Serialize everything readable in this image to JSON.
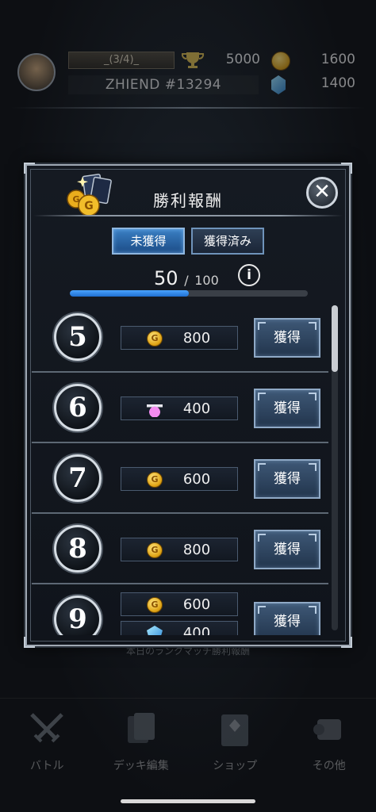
{
  "header": {
    "rank_label": "_(3/4)_",
    "trophy_count": "5000",
    "coin_count": "1600",
    "player_name": "ZHIEND  #13294",
    "gem_count": "1400",
    "icons": {
      "avatar": "avatar",
      "trophy": "trophy-icon",
      "coin": "gold-coin-icon",
      "gem": "blue-gem-icon"
    }
  },
  "modal": {
    "title": "勝利報酬",
    "close_label": "✕",
    "tabs": [
      {
        "label": "未獲得",
        "active": true
      },
      {
        "label": "獲得済み",
        "active": false
      }
    ],
    "progress": {
      "current": "50",
      "separator": "/",
      "total": "100",
      "fraction": 0.5
    },
    "info_label": "i",
    "claim_label": "獲得",
    "rewards": [
      {
        "number": "5",
        "items": [
          {
            "icon": "gold-coin-icon",
            "amount": "800"
          }
        ]
      },
      {
        "number": "6",
        "items": [
          {
            "icon": "potion-icon",
            "amount": "400"
          }
        ]
      },
      {
        "number": "7",
        "items": [
          {
            "icon": "gold-coin-icon",
            "amount": "600"
          }
        ]
      },
      {
        "number": "8",
        "items": [
          {
            "icon": "gold-coin-icon",
            "amount": "800"
          }
        ]
      },
      {
        "number": "9",
        "items": [
          {
            "icon": "gold-coin-icon",
            "amount": "600"
          },
          {
            "icon": "blue-gem-icon",
            "amount": "400"
          }
        ]
      }
    ]
  },
  "background": {
    "daily_label": "本日のランクマッチ勝利報酬",
    "nav": [
      {
        "label": "バトル",
        "icon": "crossed-swords-icon"
      },
      {
        "label": "デッキ編集",
        "icon": "deck-icon"
      },
      {
        "label": "ショップ",
        "icon": "shop-icon"
      },
      {
        "label": "その他",
        "icon": "scroll-icon"
      }
    ]
  },
  "colors": {
    "accent": "#1f6fd1",
    "modal_bg": "#131820",
    "frame": "#9fa8b3"
  }
}
